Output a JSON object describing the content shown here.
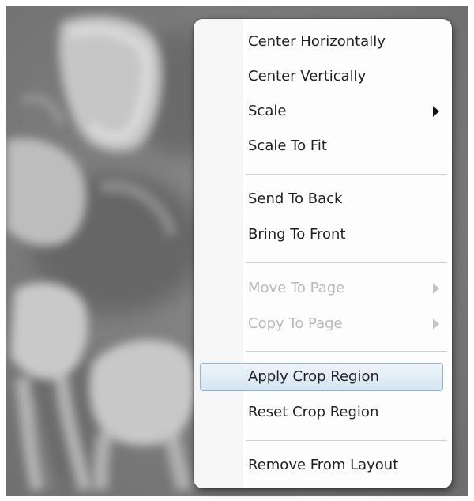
{
  "background": {
    "image": "dental-xray",
    "tones": {
      "base": "#7b7b7b",
      "dark": "#5c5c5c",
      "light": "#d0d0d0"
    }
  },
  "context_menu": {
    "sections": [
      [
        {
          "label": "Center Horizontally",
          "enabled": true
        },
        {
          "label": "Center Vertically",
          "enabled": true
        },
        {
          "label": "Scale",
          "enabled": true,
          "submenu": true
        },
        {
          "label": "Scale To Fit",
          "enabled": true
        }
      ],
      [
        {
          "label": "Send To Back",
          "enabled": true
        },
        {
          "label": "Bring To Front",
          "enabled": true
        }
      ],
      [
        {
          "label": "Move To Page",
          "enabled": false,
          "submenu": true
        },
        {
          "label": "Copy To Page",
          "enabled": false,
          "submenu": true
        }
      ],
      [
        {
          "label": "Apply Crop Region",
          "enabled": true,
          "highlighted": true
        },
        {
          "label": "Reset Crop Region",
          "enabled": true
        }
      ],
      [
        {
          "label": "Remove From Layout",
          "enabled": true
        }
      ]
    ],
    "colors": {
      "highlight_border": "#8fb4d4",
      "text": "#1f1f1f",
      "disabled_text": "#b9b9b9"
    }
  }
}
